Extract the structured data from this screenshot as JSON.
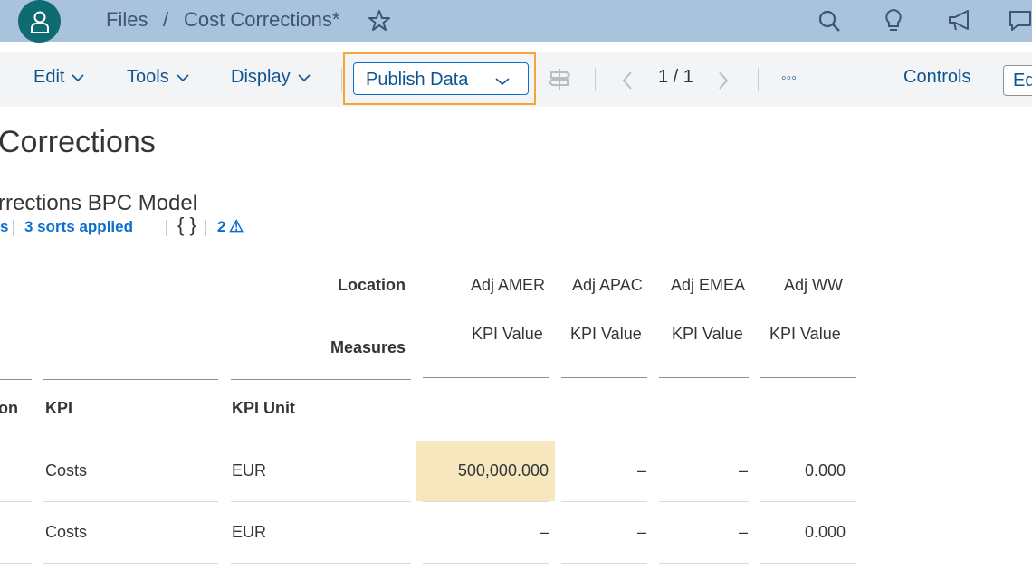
{
  "shell": {
    "breadcrumb_root": "Files",
    "breadcrumb_sep": "/",
    "file_title": "Cost Corrections*",
    "icons": [
      "user-icon",
      "star-icon",
      "search-icon",
      "lightbulb-icon",
      "megaphone-icon",
      "chat-icon"
    ]
  },
  "toolbar": {
    "edit_label": "Edit",
    "tools_label": "Tools",
    "display_label": "Display",
    "publish_label": "Publish Data",
    "pager": "1 / 1",
    "more_label": "◦◦◦",
    "controls_label": "Controls",
    "edit_mode_label": "Edit"
  },
  "page": {
    "title": "Corrections",
    "subtitle": "rrections BPC Model",
    "filters_fragment": "s",
    "sorts_applied": "3 sorts applied",
    "formula_label": "{ }",
    "warnings_count": "2",
    "warning_symbol": "⚠"
  },
  "table": {
    "header_row1_label": "Location",
    "header_row2_label": "Measures",
    "columns": [
      {
        "location": "Adj AMER",
        "measure": "KPI Value"
      },
      {
        "location": "Adj APAC",
        "measure": "KPI Value"
      },
      {
        "location": "Adj EMEA",
        "measure": "KPI Value"
      },
      {
        "location": "Adj WW",
        "measure": "KPI Value"
      }
    ],
    "row_headers": [
      "on",
      "KPI",
      "KPI Unit"
    ],
    "rows": [
      {
        "kpi": "Costs",
        "unit": "EUR",
        "values": [
          "500,000.000",
          "–",
          "–",
          "0.000"
        ]
      },
      {
        "kpi": "Costs",
        "unit": "EUR",
        "values": [
          "–",
          "–",
          "–",
          "0.000"
        ]
      }
    ],
    "highlight_color": "#f7e7bf"
  },
  "colors": {
    "shell_bg": "#aac3dd",
    "avatar_bg": "#0f6b72",
    "accent": "#0a6ed1",
    "focus_outline": "#f3a53a"
  }
}
